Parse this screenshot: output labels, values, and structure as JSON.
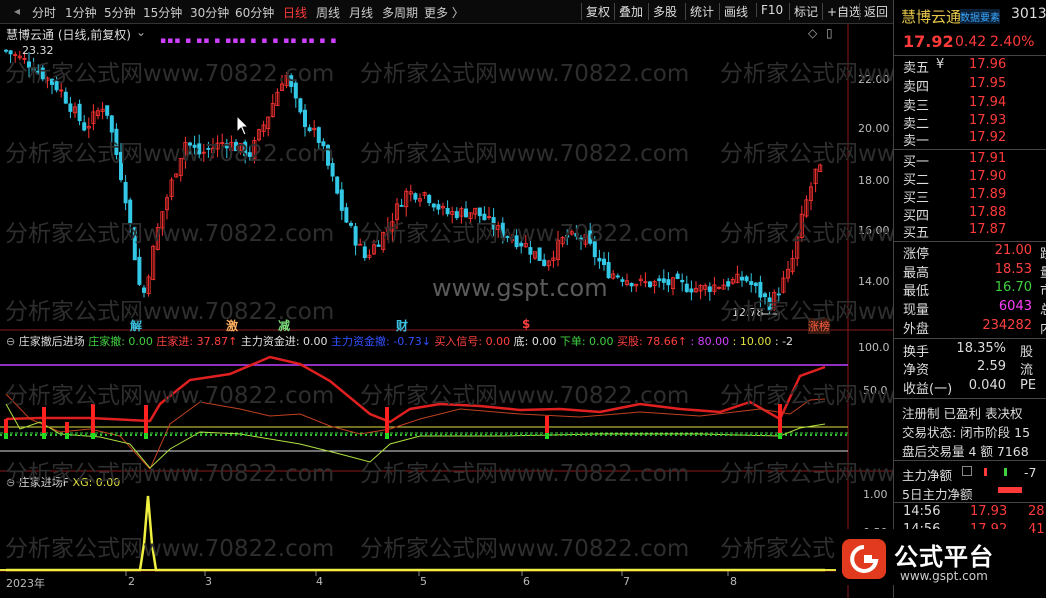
{
  "toolbar": {
    "periods": [
      "分时",
      "1分钟",
      "5分钟",
      "15分钟",
      "30分钟",
      "60分钟",
      "日线",
      "周线",
      "月线",
      "多周期",
      "更多 〉"
    ],
    "active_period": "日线",
    "right_buttons": [
      "复权",
      "叠加",
      "多股",
      "统计",
      "画线",
      "F10",
      "标记",
      "+自选",
      "返回"
    ]
  },
  "stock": {
    "name": "慧博云通",
    "main_title": "慧博云通 (日线,前复权)",
    "code_partial": "3013",
    "tag": "数据要素",
    "price": "17.92",
    "change": "0.42",
    "change_pct": "2.40%"
  },
  "chart_data": {
    "type": "candlestick",
    "price_axis": [
      "22.00",
      "20.00",
      "18.00",
      "16.00",
      "14.00"
    ],
    "ylim": [
      12.2,
      23.8
    ],
    "price_labels": {
      "high": "23.32",
      "low": "12.78"
    },
    "top_markers": "▪▪▪  ▪ ▪▪  ▪  ▪▪▪ ▪  ▪  ▪ ▪▪ ▪▪ ▪  ▪",
    "event_labels": [
      {
        "text": "解",
        "color": "#3cc0e0"
      },
      {
        "text": "激",
        "color": "#ffb060"
      },
      {
        "text": "减",
        "color": "#7cdc7c"
      },
      {
        "text": "财",
        "color": "#3cc0e0"
      },
      {
        "text": "$",
        "color": "#ff4040"
      },
      {
        "text": "涨榜",
        "color": "#ff6040"
      }
    ],
    "x_axis": [
      "2023年",
      "2",
      "3",
      "4",
      "5",
      "6",
      "7",
      "8"
    ],
    "indicator1": {
      "name": "庄家撤后进场",
      "axis": [
        "100.0",
        "50.0"
      ],
      "legend": [
        {
          "text": "庄家撤: 0.00",
          "color": "#40d040"
        },
        {
          "text": "庄家进: 37.87↑",
          "color": "#ff4040"
        },
        {
          "text": "主力资金进: 0.00",
          "color": "#e0e0e0"
        },
        {
          "text": "主力资金撤: -0.73↓",
          "color": "#3050ff"
        },
        {
          "text": "买入信号: 0.00",
          "color": "#ff4040"
        },
        {
          "text": "底: 0.00",
          "color": "#e0e0e0"
        },
        {
          "text": "下单: 0.00",
          "color": "#40d040"
        },
        {
          "text": "买股: 78.66↑",
          "color": "#ff4040"
        },
        {
          "text": ": 80.00",
          "color": "#d040ff"
        },
        {
          "text": ": 10.00",
          "color": "#e0e040"
        },
        {
          "text": ": -2",
          "color": "#e0e0e0"
        }
      ]
    },
    "indicator2": {
      "name": "庄家进场F",
      "legend": "XG: 0.00",
      "axis": [
        "1.00",
        "0.50"
      ]
    }
  },
  "orderbook": {
    "sell": [
      {
        "label": "卖五",
        "sub": "¥",
        "price": "17.96"
      },
      {
        "label": "卖四",
        "price": "17.95"
      },
      {
        "label": "卖三",
        "price": "17.94"
      },
      {
        "label": "卖二",
        "price": "17.93"
      },
      {
        "label": "卖一",
        "price": "17.92"
      }
    ],
    "buy": [
      {
        "label": "买一",
        "price": "17.91"
      },
      {
        "label": "买二",
        "price": "17.90"
      },
      {
        "label": "买三",
        "price": "17.89"
      },
      {
        "label": "买四",
        "price": "17.88"
      },
      {
        "label": "买五",
        "price": "17.87"
      }
    ]
  },
  "stats": [
    {
      "k": "涨停",
      "v": "21.00",
      "c": "#ff4040",
      "x": "跌"
    },
    {
      "k": "最高",
      "v": "18.53",
      "c": "#ff4040",
      "x": "量"
    },
    {
      "k": "最低",
      "v": "16.70",
      "c": "#40d040",
      "x": "市"
    },
    {
      "k": "现量",
      "v": "6043",
      "c": "#ff40ff",
      "x": "总"
    },
    {
      "k": "外盘",
      "v": "234282",
      "c": "#ff4040",
      "x": "内"
    }
  ],
  "stats2": [
    {
      "k": "换手",
      "v": "18.35%",
      "x": "股"
    },
    {
      "k": "净资",
      "v": "2.59",
      "x": "流"
    },
    {
      "k": "收益(一)",
      "v": "0.040",
      "x": "PE"
    }
  ],
  "info": {
    "line1": "注册制  已盈利  表决权",
    "line2": "交易状态: 闭市阶段 15",
    "line3": "盘后交易量 4 额 7168"
  },
  "flow": {
    "row1_label": "主力净额",
    "row1_value": "-7",
    "row2_label": "5日主力净额"
  },
  "ticks": [
    {
      "time": "14:56",
      "price": "17.93",
      "vol": "28"
    },
    {
      "time": "14:56",
      "price": "17.92",
      "vol": "41"
    }
  ],
  "watermark": {
    "text": "分析家公式网www.70822.com",
    "site": "www.gspt.com",
    "badge": "公式平台",
    "badge_url": "www.gspt.com"
  },
  "colors": {
    "up": "#ff3333",
    "down": "#33c8e6",
    "accent": "#ff3a3a",
    "green": "#40d040"
  }
}
